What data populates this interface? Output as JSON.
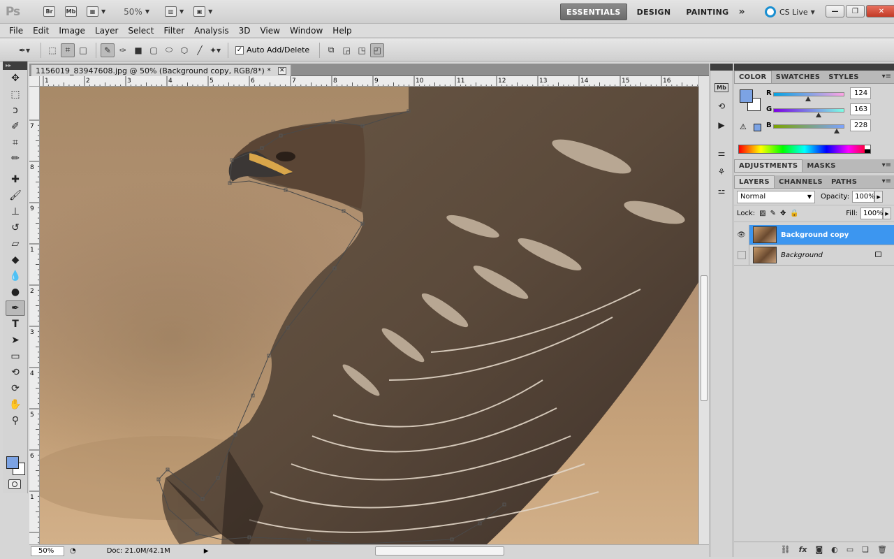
{
  "app": {
    "logo": "Ps",
    "bridge": "Br",
    "mini_bridge": "Mb",
    "zoom": "50%",
    "workspaces": [
      "ESSENTIALS",
      "DESIGN",
      "PAINTING"
    ],
    "more": "»",
    "cs_live": "CS Live"
  },
  "menu": [
    "File",
    "Edit",
    "Image",
    "Layer",
    "Select",
    "Filter",
    "Analysis",
    "3D",
    "View",
    "Window",
    "Help"
  ],
  "options": {
    "auto_add_delete": "Auto Add/Delete"
  },
  "document": {
    "tab_title": "1156019_83947608.jpg @ 50% (Background copy, RGB/8*) *",
    "ruler_top": [
      "1",
      "2",
      "3",
      "4",
      "5",
      "6",
      "7",
      "8",
      "9",
      "10",
      "11",
      "12",
      "13",
      "14",
      "15",
      "16"
    ],
    "ruler_left": [
      "7",
      "8",
      "9",
      "1",
      "2",
      "3",
      "4",
      "5",
      "6",
      "1"
    ],
    "status_zoom": "50%",
    "status_doc": "Doc: 21.0M/42.1M"
  },
  "color_panel": {
    "tabs": [
      "COLOR",
      "SWATCHES",
      "STYLES"
    ],
    "r_label": "R",
    "g_label": "G",
    "b_label": "B",
    "r": "124",
    "g": "163",
    "b": "228",
    "r_frac": 0.486,
    "g_frac": 0.639,
    "b_frac": 0.894,
    "fg_color": "#7ca3e4"
  },
  "adjustments_tabs": [
    "ADJUSTMENTS",
    "MASKS"
  ],
  "layers_panel": {
    "tabs": [
      "LAYERS",
      "CHANNELS",
      "PATHS"
    ],
    "blend_mode": "Normal",
    "opacity_label": "Opacity:",
    "opacity": "100%",
    "lock_label": "Lock:",
    "fill_label": "Fill:",
    "fill": "100%",
    "layers": [
      {
        "name": "Background copy",
        "selected": true,
        "visible": true
      },
      {
        "name": "Background",
        "selected": false,
        "visible": false
      }
    ]
  },
  "colors": {
    "selection": "#3c96f0",
    "foreground": "#7ca3e4"
  }
}
